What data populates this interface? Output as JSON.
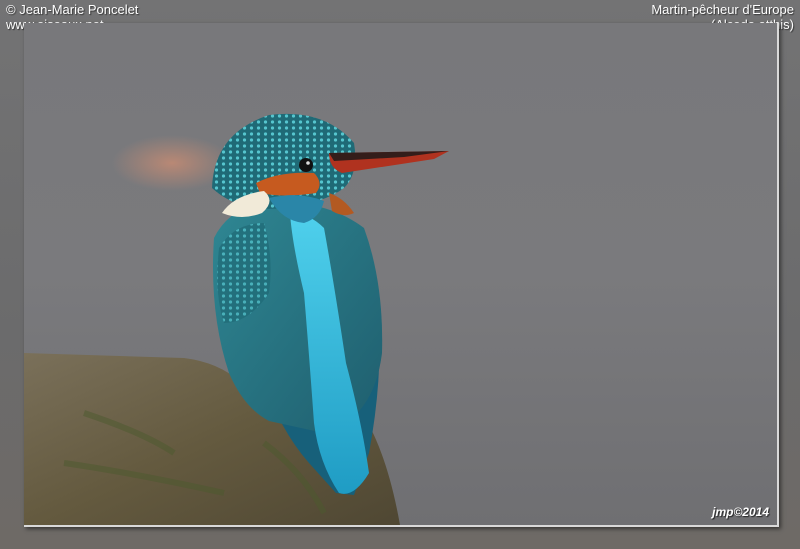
{
  "credit": {
    "author": "© Jean-Marie Poncelet",
    "website": "www.oiseaux.net"
  },
  "species": {
    "common_name": "Martin-pêcheur d'Europe",
    "scientific_name": "(Alcedo atthis)"
  },
  "photo": {
    "signature": "jmp©2014",
    "subject": "bird",
    "colors": {
      "background": "#77777a",
      "plumage_blue": "#27b4d6",
      "plumage_teal": "#2d7f8c",
      "orange": "#c65a1f",
      "bill": "#c2372a",
      "perch": "#6d6447"
    }
  }
}
